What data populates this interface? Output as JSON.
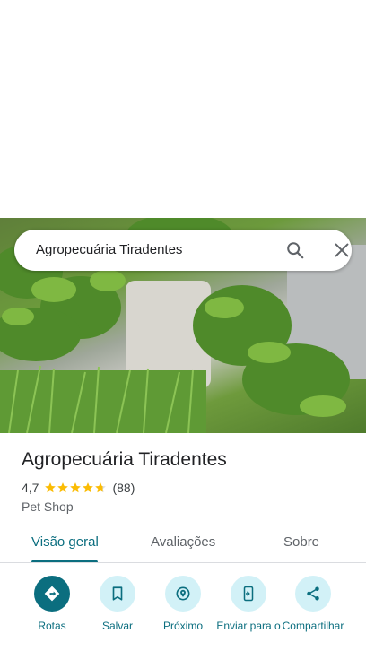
{
  "search": {
    "query": "Agropecuária Tiradentes"
  },
  "place": {
    "name": "Agropecuária Tiradentes",
    "rating": "4,7",
    "stars": 4.7,
    "review_count": "(88)",
    "category": "Pet Shop"
  },
  "tabs": [
    {
      "label": "Visão geral",
      "active": true
    },
    {
      "label": "Avaliações",
      "active": false
    },
    {
      "label": "Sobre",
      "active": false
    }
  ],
  "actions": [
    {
      "label": "Rotas",
      "icon": "directions-icon",
      "primary": true
    },
    {
      "label": "Salvar",
      "icon": "bookmark-icon",
      "primary": false
    },
    {
      "label": "Próximo",
      "icon": "nearby-icon",
      "primary": false
    },
    {
      "label": "Enviar para o",
      "icon": "send-to-phone-icon",
      "primary": false
    },
    {
      "label": "Compartilhar",
      "icon": "share-icon",
      "primary": false
    }
  ],
  "colors": {
    "accent": "#0b6e7f",
    "action_bg": "#d2f1f7",
    "star": "#fbbc04"
  }
}
